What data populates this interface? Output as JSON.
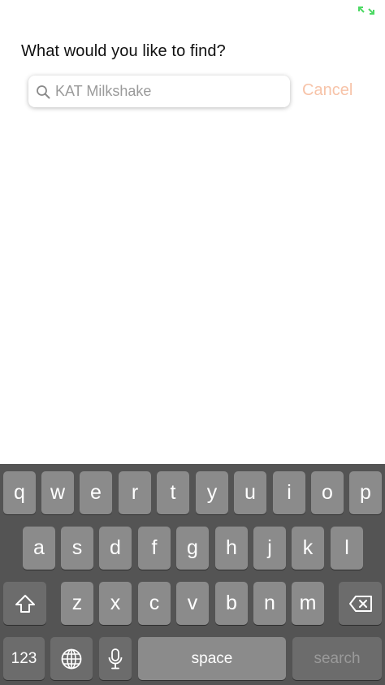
{
  "status_bar": {
    "icon": "expand-arrows-icon",
    "accent_color": "#4cd964"
  },
  "search_screen": {
    "prompt": "What would you like to find?",
    "search": {
      "placeholder": "KAT Milkshake",
      "value": ""
    },
    "cancel_label": "Cancel",
    "cancel_color": "#f7c3a8"
  },
  "keyboard": {
    "row1": [
      "q",
      "w",
      "e",
      "r",
      "t",
      "y",
      "u",
      "i",
      "o",
      "p"
    ],
    "row2": [
      "a",
      "s",
      "d",
      "f",
      "g",
      "h",
      "j",
      "k",
      "l"
    ],
    "row3": [
      "z",
      "x",
      "c",
      "v",
      "b",
      "n",
      "m"
    ],
    "numbers_label": "123",
    "space_label": "space",
    "search_label": "search",
    "icons": {
      "shift": "shift-icon",
      "delete": "backspace-icon",
      "globe": "globe-icon",
      "mic": "microphone-icon"
    }
  }
}
